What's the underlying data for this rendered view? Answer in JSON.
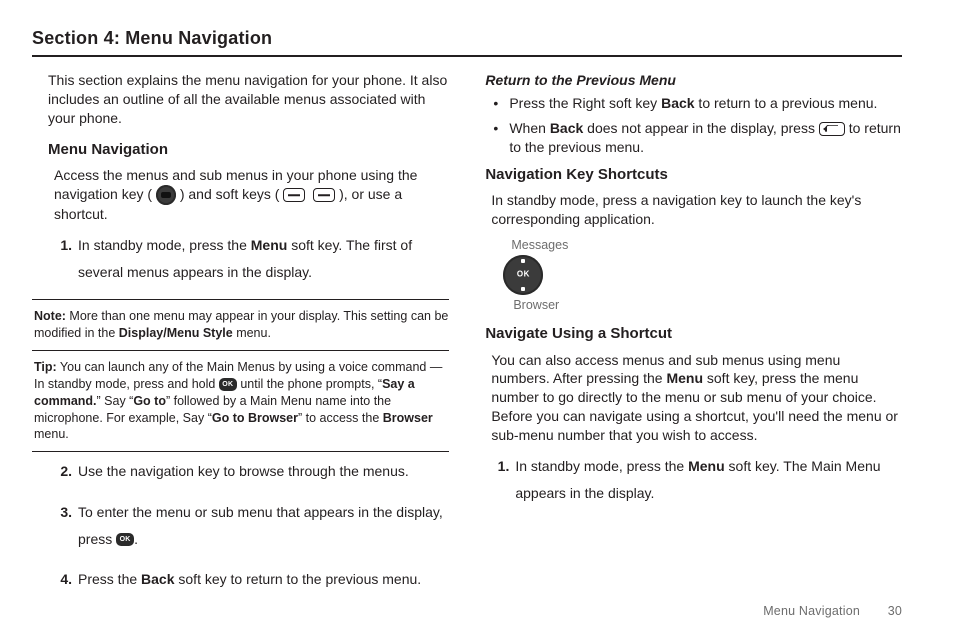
{
  "section_title": "Section 4: Menu Navigation",
  "left": {
    "intro": "This section explains the menu navigation for your phone. It also includes an outline of all the available menus associated with your phone.",
    "h_menu_nav": "Menu Navigation",
    "access_a": "Access the menus and sub menus in your phone using the navigation key (",
    "access_b": ") and soft keys (",
    "access_c": "), or use a shortcut.",
    "step1_a": "In standby mode, press the ",
    "step1_menu": "Menu",
    "step1_b": " soft key. The first of several menus appears in the display.",
    "note_lbl": "Note:",
    "note_a": " More than one menu may appear in your display. This setting can be modified in the ",
    "note_bold": "Display/Menu Style",
    "note_b": " menu.",
    "tip_lbl": "Tip:",
    "tip_a": " You can launch any of the Main Menus by using a voice command — In standby mode, press and hold ",
    "tip_b": " until the phone prompts, “",
    "tip_say": "Say a command.",
    "tip_c": "” Say “",
    "tip_goto": "Go to",
    "tip_d": "” followed by a Main Menu name into the microphone. For example, Say “",
    "tip_gotob": "Go to Browser",
    "tip_e": "” to access the ",
    "tip_browser": "Browser",
    "tip_f": " menu.",
    "step2": "Use the navigation key to browse through the menus.",
    "step3_a": "To enter the menu or sub menu that appears in the display, press ",
    "step3_b": ".",
    "step4_a": "Press the ",
    "step4_back": "Back",
    "step4_b": " soft key to return to the previous menu."
  },
  "right": {
    "h_return": "Return to the Previous Menu",
    "b1_a": "Press the Right soft key ",
    "b1_back": "Back",
    "b1_b": " to return to a previous menu.",
    "b2_a": "When ",
    "b2_back": "Back",
    "b2_b": " does not appear in the display, press ",
    "b2_c": " to return to the previous menu.",
    "h_navshort": "Navigation Key Shortcuts",
    "navshort_p": "In standby mode, press a navigation key to launch the key's corresponding application.",
    "diag_top": "Messages",
    "diag_bot": "Browser",
    "h_shortcut": "Navigate Using a Shortcut",
    "shortcut_a": "You can also access menus and sub menus using menu numbers. After pressing the ",
    "shortcut_menu": "Menu",
    "shortcut_b": " soft key, press the menu number to go directly to the menu or sub menu of your choice. Before you can navigate using a shortcut, you'll need the menu or sub-menu number that you wish to access.",
    "r_step1_a": "In standby mode, press the ",
    "r_step1_menu": "Menu",
    "r_step1_b": " soft key. The Main Menu appears in the display."
  },
  "footer": {
    "label": "Menu Navigation",
    "page": "30"
  },
  "ok_label": "OK"
}
